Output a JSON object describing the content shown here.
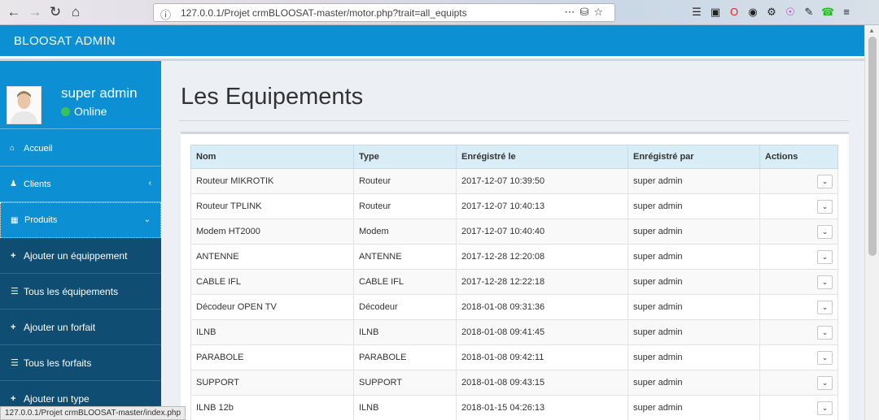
{
  "browser": {
    "url": "127.0.0.1/Projet crmBLOOSAT-master/motor.php?trait=all_equipts",
    "status_url": "127.0.0.1/Projet crmBLOOSAT-master/index.php"
  },
  "header": {
    "title": "BLOOSAT ADMIN"
  },
  "user": {
    "name": "super admin",
    "status": "Online"
  },
  "sidebar": {
    "items": [
      {
        "label": "Accueil",
        "icon": "home-icon"
      },
      {
        "label": "Clients",
        "icon": "users-icon"
      },
      {
        "label": "Produits",
        "icon": "cubes-icon"
      }
    ],
    "subitems": [
      {
        "label": "Ajouter un équippement",
        "icon": "plus-icon"
      },
      {
        "label": "Tous les équipements",
        "icon": "list-icon"
      },
      {
        "label": "Ajouter un forfait",
        "icon": "plus-icon"
      },
      {
        "label": "Tous les forfaits",
        "icon": "list-icon"
      },
      {
        "label": "Ajouter un type",
        "icon": "plus-icon"
      }
    ]
  },
  "main": {
    "page_title": "Les Equipements",
    "table": {
      "headers": [
        "Nom",
        "Type",
        "Enrégistré le",
        "Enrégistré par",
        "Actions"
      ],
      "rows": [
        [
          "Routeur MIKROTIK",
          "Routeur",
          "2017-12-07 10:39:50",
          "super admin"
        ],
        [
          "Routeur TPLINK",
          "Routeur",
          "2017-12-07 10:40:13",
          "super admin"
        ],
        [
          "Modem HT2000",
          "Modem",
          "2017-12-07 10:40:40",
          "super admin"
        ],
        [
          "ANTENNE",
          "ANTENNE",
          "2017-12-28 12:20:08",
          "super admin"
        ],
        [
          "CABLE IFL",
          "CABLE IFL",
          "2017-12-28 12:22:18",
          "super admin"
        ],
        [
          "Décodeur OPEN TV",
          "Décodeur",
          "2018-01-08 09:31:36",
          "super admin"
        ],
        [
          "ILNB",
          "ILNB",
          "2018-01-08 09:41:45",
          "super admin"
        ],
        [
          "PARABOLE",
          "PARABOLE",
          "2018-01-08 09:42:11",
          "super admin"
        ],
        [
          "SUPPORT",
          "SUPPORT",
          "2018-01-08 09:43:15",
          "super admin"
        ],
        [
          "ILNB 12b",
          "ILNB",
          "2018-01-15 04:26:13",
          "super admin"
        ]
      ]
    }
  },
  "colors": {
    "accent": "#0c90d3",
    "submenu": "#0f4d72",
    "table_header": "#d9edf7",
    "online": "#3ac25a"
  }
}
